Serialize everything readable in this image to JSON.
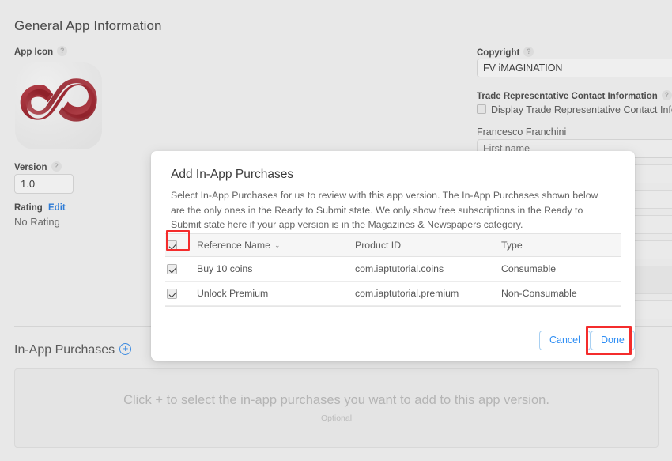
{
  "page": {
    "title": "General App Information"
  },
  "app_icon": {
    "label": "App Icon",
    "help": "?",
    "icon_name": "infinity-loop-logo"
  },
  "version": {
    "label": "Version",
    "help": "?",
    "value": "1.0"
  },
  "rating": {
    "label": "Rating",
    "edit_label": "Edit",
    "value": "No Rating"
  },
  "copyright": {
    "label": "Copyright",
    "help": "?",
    "value": "FV iMAGINATION"
  },
  "trade_representative": {
    "label": "Trade Representative Contact Information",
    "help": "?",
    "checkbox_label": "Display Trade Representative Contact Inform",
    "checked": false,
    "person_name": "Francesco Franchini",
    "first_name_placeholder": "First name",
    "first_name_value": ""
  },
  "in_app_purchases_section": {
    "heading": "In-App Purchases",
    "add_icon": "plus-circle-icon",
    "dropzone_text": "Click + to select the in-app purchases you want to add to this app version.",
    "dropzone_sub": "Optional"
  },
  "modal": {
    "title": "Add In-App Purchases",
    "description": "Select In-App Purchases for us to review with this app version. The In-App Purchases shown below are the only ones in the Ready to Submit state. We only show free subscriptions in the Ready to Submit state here if your app version is in the Magazines & Newspapers category.",
    "table": {
      "select_all_checked": true,
      "sort_caret": "⌄",
      "columns": [
        "Reference Name",
        "Product ID",
        "Type"
      ],
      "rows": [
        {
          "checked": true,
          "reference_name": "Buy 10 coins",
          "product_id": "com.iaptutorial.coins",
          "type": "Consumable"
        },
        {
          "checked": true,
          "reference_name": "Unlock Premium",
          "product_id": "com.iaptutorial.premium",
          "type": "Non-Consumable"
        }
      ]
    },
    "buttons": {
      "cancel": "Cancel",
      "done": "Done"
    }
  },
  "annotations": {
    "highlight_color": "#f42c2c",
    "targets": [
      "select-all-checkbox",
      "done-button"
    ]
  },
  "colors": {
    "page_background": "#e8e8e8",
    "modal_background": "#ffffff",
    "accent_blue": "#2f8ef4",
    "link_blue": "#2f7cd6",
    "logo_red": "#a8333d"
  }
}
